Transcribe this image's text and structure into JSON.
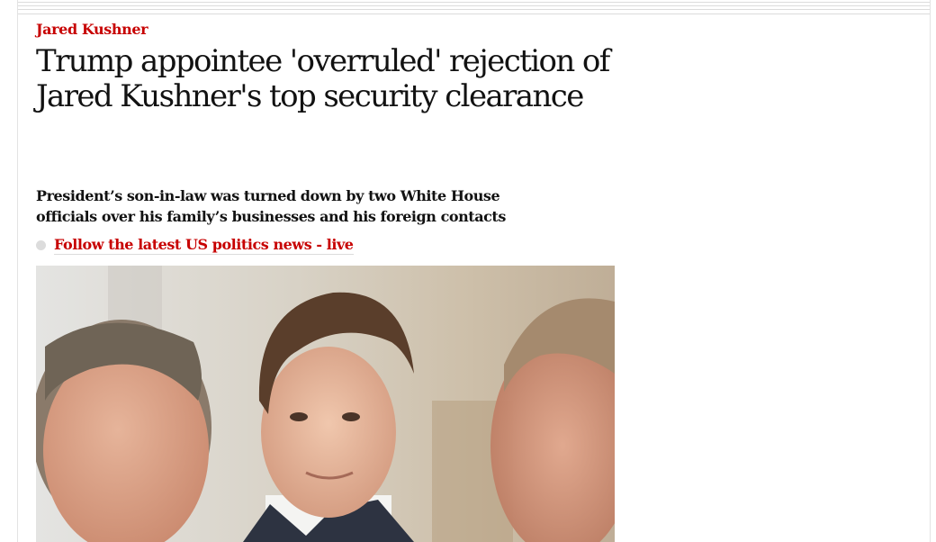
{
  "article": {
    "kicker": "Jared Kushner",
    "headline": "Trump appointee 'overruled' rejection of Jared Kushner's top security clearance",
    "standfirst": "President’s son-in-law was turned down by two White House officials over his family’s businesses and his foreign contacts",
    "live_link": {
      "label": "Follow the latest US politics news - live",
      "icon": "bullet-icon"
    }
  },
  "colors": {
    "accent": "#c70000",
    "text": "#121212",
    "rule": "#dcdcdc"
  }
}
